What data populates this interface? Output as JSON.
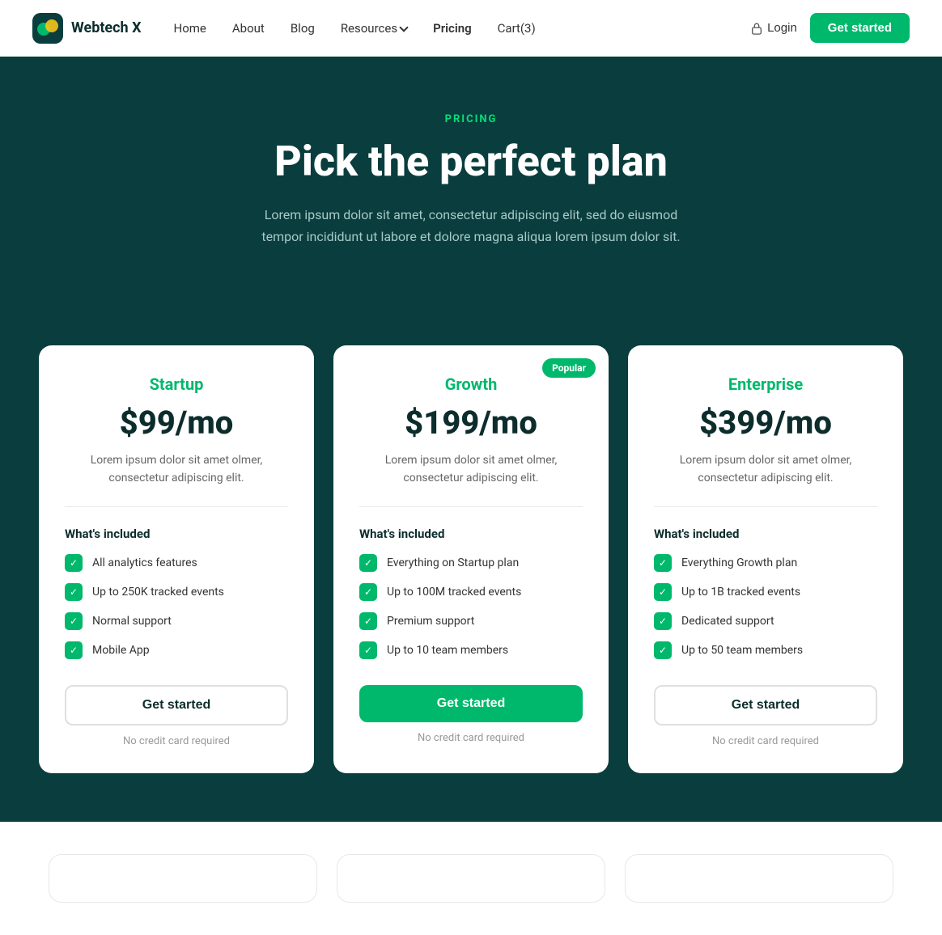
{
  "navbar": {
    "logo_text": "Webtech X",
    "links": [
      {
        "label": "Home",
        "name": "home"
      },
      {
        "label": "About",
        "name": "about"
      },
      {
        "label": "Blog",
        "name": "blog"
      },
      {
        "label": "Resources",
        "name": "resources",
        "has_dropdown": true
      },
      {
        "label": "Pricing",
        "name": "pricing"
      },
      {
        "label": "Cart(3)",
        "name": "cart"
      }
    ],
    "login_label": "Login",
    "get_started_label": "Get started"
  },
  "hero": {
    "label": "PRICING",
    "title": "Pick the perfect plan",
    "description": "Lorem ipsum dolor sit amet, consectetur adipiscing elit, sed do eiusmod tempor incididunt ut labore et dolore magna aliqua lorem ipsum dolor sit."
  },
  "plans": [
    {
      "name": "Startup",
      "price": "$99/mo",
      "description": "Lorem ipsum dolor sit amet olmer, consectetur adipiscing elit.",
      "whats_included": "What's included",
      "features": [
        "All analytics features",
        "Up to 250K tracked events",
        "Normal support",
        "Mobile App"
      ],
      "cta": "Get started",
      "no_credit": "No credit card required",
      "popular": false,
      "cta_type": "secondary"
    },
    {
      "name": "Growth",
      "price": "$199/mo",
      "description": "Lorem ipsum dolor sit amet olmer, consectetur adipiscing elit.",
      "whats_included": "What's included",
      "features": [
        "Everything on Startup plan",
        "Up to 100M tracked events",
        "Premium support",
        "Up to 10 team members"
      ],
      "cta": "Get started",
      "no_credit": "No credit card required",
      "popular": true,
      "popular_label": "Popular",
      "cta_type": "primary"
    },
    {
      "name": "Enterprise",
      "price": "$399/mo",
      "description": "Lorem ipsum dolor sit amet olmer, consectetur adipiscing elit.",
      "whats_included": "What's included",
      "features": [
        "Everything Growth plan",
        "Up to 1B tracked events",
        "Dedicated support",
        "Up to 50 team members"
      ],
      "cta": "Get started",
      "no_credit": "No credit card required",
      "popular": false,
      "cta_type": "secondary"
    }
  ]
}
